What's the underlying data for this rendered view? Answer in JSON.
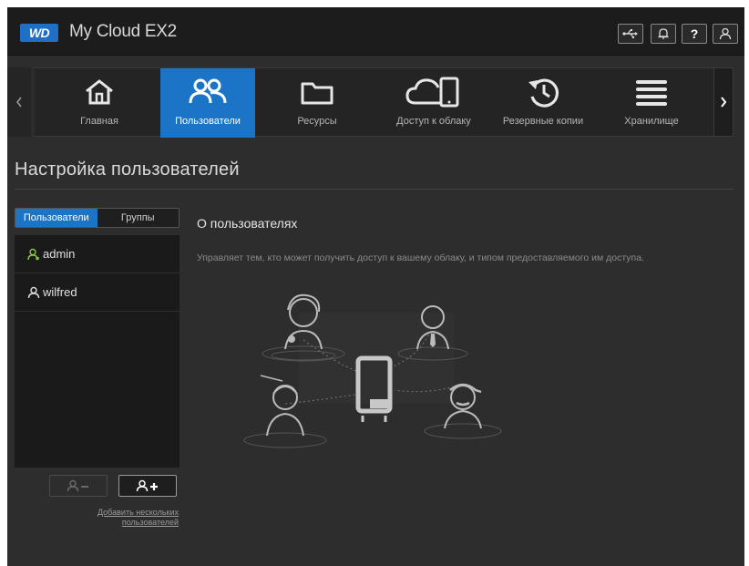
{
  "header": {
    "logo_text": "WD",
    "app_title": "My Cloud EX2",
    "buttons": [
      {
        "icon": "usb-icon"
      },
      {
        "icon": "bell-icon"
      },
      {
        "icon": "help-icon"
      },
      {
        "icon": "user-icon"
      }
    ]
  },
  "nav": {
    "items": [
      {
        "label": "Главная",
        "icon": "home-icon",
        "active": false
      },
      {
        "label": "Пользователи",
        "icon": "users-icon",
        "active": true
      },
      {
        "label": "Ресурсы",
        "icon": "folder-icon",
        "active": false
      },
      {
        "label": "Доступ к облаку",
        "icon": "cloud-device-icon",
        "active": false
      },
      {
        "label": "Резервные копии",
        "icon": "backup-icon",
        "active": false
      },
      {
        "label": "Хранилище",
        "icon": "storage-icon",
        "active": false
      }
    ]
  },
  "page": {
    "title": "Настройка пользователей"
  },
  "sidebar": {
    "tabs": [
      {
        "label": "Пользователи",
        "active": true
      },
      {
        "label": "Группы",
        "active": false
      }
    ],
    "users": [
      {
        "name": "admin",
        "admin": true
      },
      {
        "name": "wilfred",
        "admin": false
      }
    ],
    "add_multiple_line1": "Добавить нескольких",
    "add_multiple_line2": "пользователей"
  },
  "content": {
    "title": "О пользователях",
    "description": "Управляет тем, кто может получить доступ к вашему облаку, и типом предоставляемого им доступа."
  },
  "colors": {
    "accent": "#1b74c5",
    "admin_icon": "#8bc34a",
    "background": "#2d2d2d"
  }
}
